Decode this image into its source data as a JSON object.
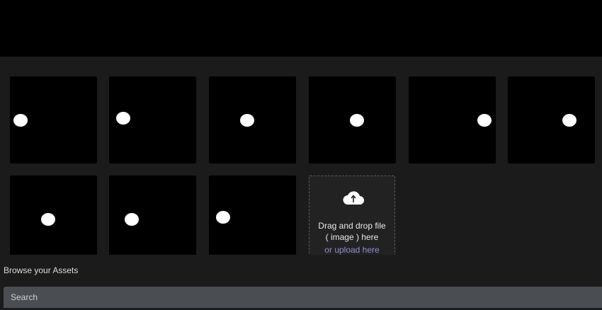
{
  "upload": {
    "line1": "Drag and drop file",
    "line2": "( image ) here",
    "line3_prefix": "or ",
    "line3_link": "upload here"
  },
  "assets": {
    "title": "Browse your Assets",
    "search_placeholder": "Search"
  },
  "colors": {
    "panel_bg": "#1b1b1b",
    "tile_bg": "#000000",
    "link": "#8e8fd6",
    "search_bg": "#4a4d52"
  }
}
